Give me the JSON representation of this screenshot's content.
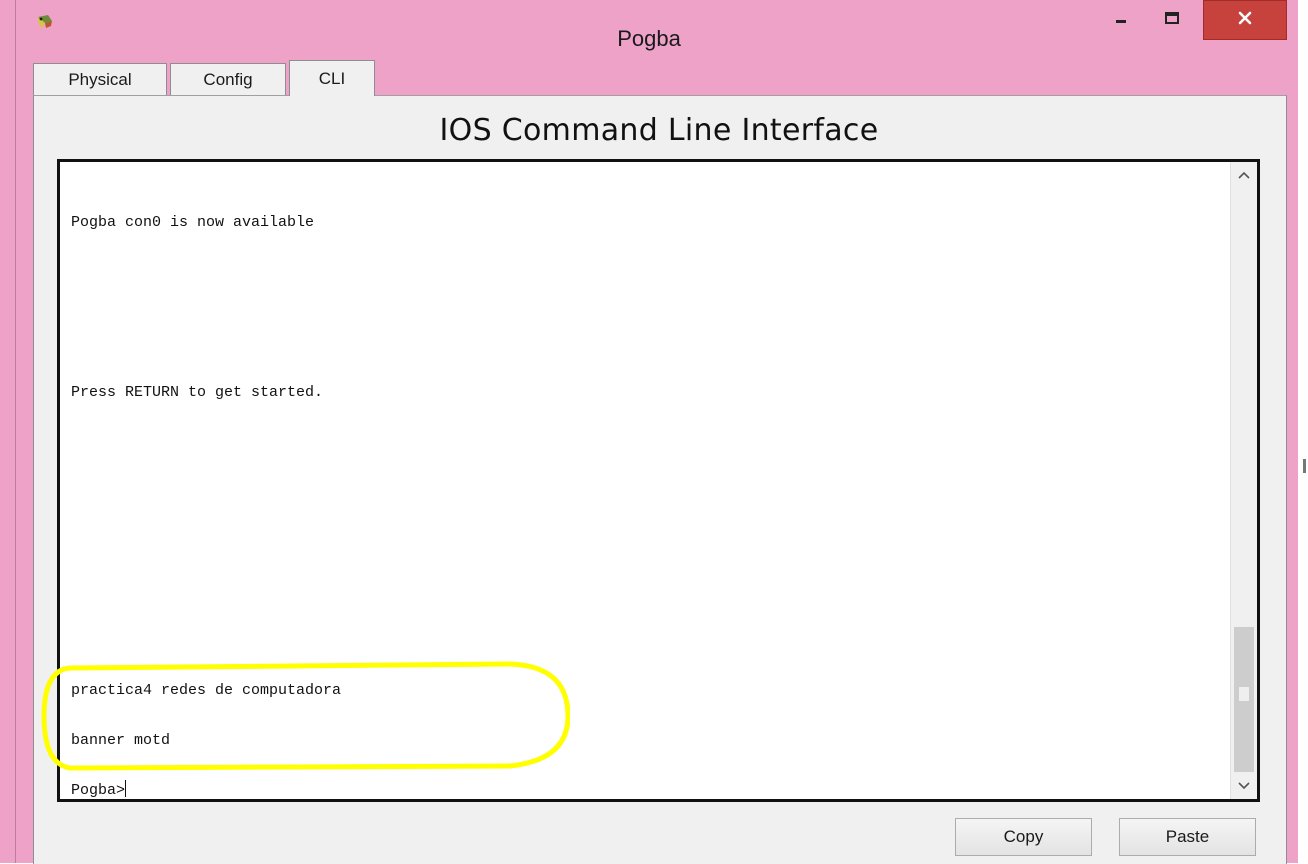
{
  "window": {
    "title": "Pogba",
    "icon": "packet-tracer-app-icon",
    "controls": [
      "minimize-icon",
      "maximize-icon",
      "close-icon"
    ],
    "title_bar_color": "#eea2c8",
    "close_button_color": "#c7423c"
  },
  "tabs": [
    {
      "label": "Physical"
    },
    {
      "label": "Config"
    },
    {
      "label": "CLI"
    }
  ],
  "active_tab": "CLI",
  "heading": "IOS Command Line Interface",
  "terminal": {
    "lines": [
      "Pogba con0 is now available",
      "Press RETURN to get started.",
      "practica4 redes de computadora",
      "banner motd",
      "Pogba>"
    ]
  },
  "highlight_color": "#ffff00",
  "buttons": {
    "copy": "Copy",
    "paste": "Paste"
  }
}
